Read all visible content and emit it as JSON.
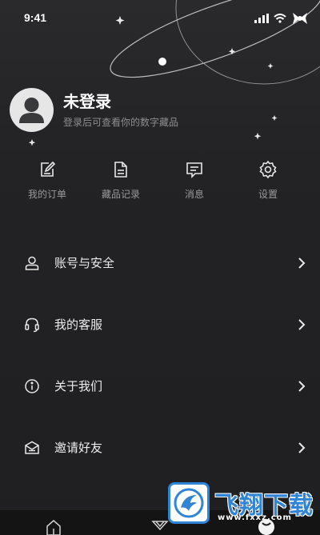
{
  "status_bar": {
    "time": "9:41"
  },
  "profile": {
    "name": "未登录",
    "subtitle": "登录后可查看你的数字藏品"
  },
  "quick_actions": [
    {
      "label": "我的订单",
      "icon": "edit-document-icon"
    },
    {
      "label": "藏品记录",
      "icon": "file-list-icon"
    },
    {
      "label": "消息",
      "icon": "message-icon"
    },
    {
      "label": "设置",
      "icon": "gear-icon"
    }
  ],
  "menu": [
    {
      "label": "账号与安全",
      "icon": "user-icon"
    },
    {
      "label": "我的客服",
      "icon": "headset-icon"
    },
    {
      "label": "关于我们",
      "icon": "info-icon"
    },
    {
      "label": "邀请好友",
      "icon": "envelope-icon"
    }
  ],
  "tab_bar": [
    {
      "icon": "home-icon"
    },
    {
      "icon": "diamond-icon"
    },
    {
      "icon": "profile-icon"
    }
  ],
  "watermark": {
    "brand": "飞翔下载",
    "url": "www.fxxz.com"
  }
}
